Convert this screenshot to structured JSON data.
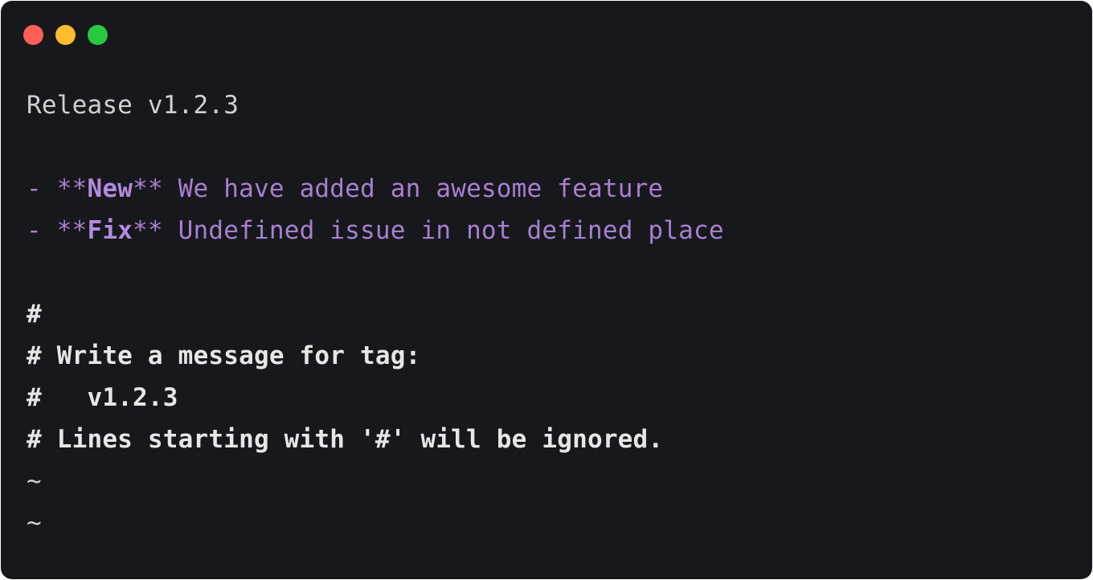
{
  "window": {
    "buttons": {
      "close_color": "#ff5f57",
      "minimize_color": "#febc2e",
      "maximize_color": "#28c840"
    }
  },
  "editor": {
    "title_line": "Release v1.2.3",
    "items": [
      {
        "bullet": "- ",
        "marker_open": "**",
        "keyword": "New",
        "marker_close": "**",
        "text": " We have added an awesome feature"
      },
      {
        "bullet": "- ",
        "marker_open": "**",
        "keyword": "Fix",
        "marker_close": "**",
        "text": " Undefined issue in not defined place"
      }
    ],
    "comments": [
      "#",
      "# Write a message for tag:",
      "#   v1.2.3",
      "# Lines starting with '#' will be ignored."
    ],
    "tildes": [
      "~",
      "~"
    ]
  }
}
